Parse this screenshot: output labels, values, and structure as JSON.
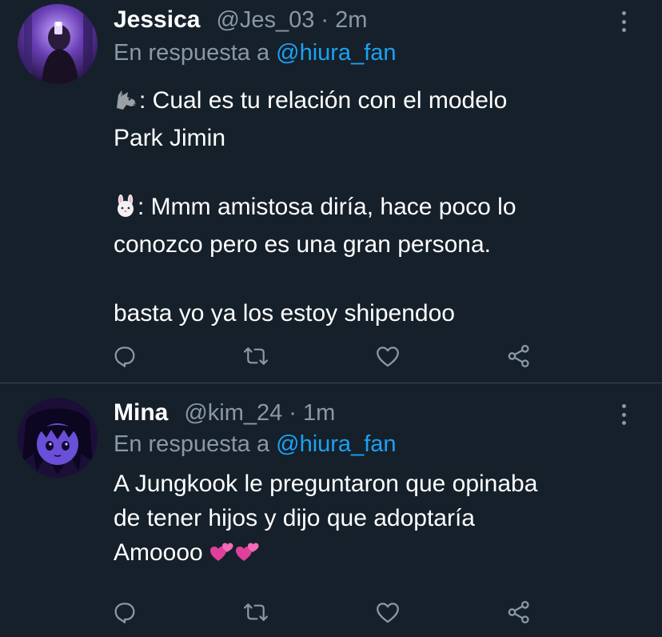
{
  "colors": {
    "background": "#15202b",
    "secondary_text": "#8899a6",
    "link": "#1da1f2",
    "divider": "#38444d"
  },
  "tweets": [
    {
      "name": "Jessica",
      "handle": "@Jes_03",
      "separator": "·",
      "time": "2m",
      "reply_prefix": "En respuesta a",
      "reply_to": "@hiura_fan",
      "lines": {
        "l1": ": Cual es tu relación con el modelo",
        "l2": "Park Jimin",
        "l3": ": Mmm amistosa diría, hace poco lo",
        "l4": "conozco pero es una gran persona.",
        "l5": "basta yo ya los estoy shipendoo"
      },
      "emojis": [
        "wolf-emoji",
        "rabbit-emoji"
      ],
      "actions": [
        "reply-icon",
        "retweet-icon",
        "like-icon",
        "share-icon"
      ]
    },
    {
      "name": "Mina",
      "handle": "@kim_24",
      "separator": "·",
      "time": "1m",
      "reply_prefix": "En respuesta a",
      "reply_to": "@hiura_fan",
      "lines": {
        "l1": "A Jungkook le preguntaron que opinaba",
        "l2": "de tener hijos y dijo que adoptaría",
        "l3": "Amoooo"
      },
      "emojis": [
        "two-hearts-emoji",
        "two-hearts-emoji"
      ],
      "actions": [
        "reply-icon",
        "retweet-icon",
        "like-icon",
        "share-icon"
      ]
    }
  ]
}
